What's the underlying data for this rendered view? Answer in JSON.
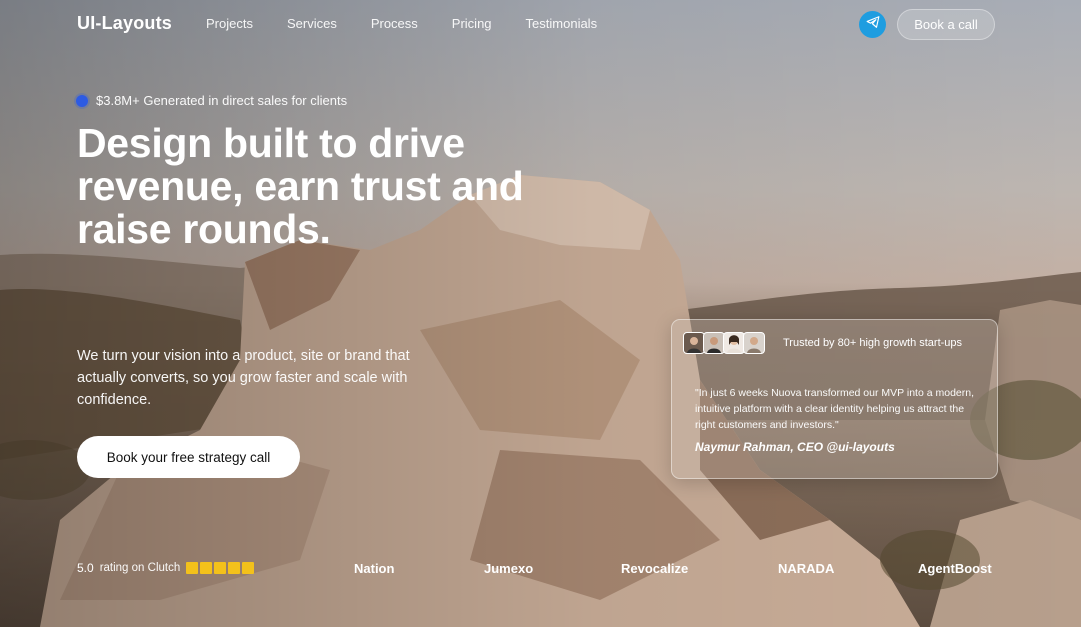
{
  "colors": {
    "accent_blue": "#2d5be3",
    "telegram_blue": "#1f9de0",
    "star_yellow": "#f3c11b"
  },
  "nav": {
    "logo": "UI-Layouts",
    "links": [
      "Projects",
      "Services",
      "Process",
      "Pricing",
      "Testimonials"
    ],
    "telegram_icon": "paper-plane-icon",
    "book_call": "Book a call"
  },
  "hero": {
    "badge_text": "$3.8M+ Generated in direct sales for clients",
    "headline": "Design built to drive revenue, earn trust and raise rounds.",
    "subtext": "We turn your vision into a product, site or brand that actually converts, so you grow faster and scale with confidence.",
    "cta": "Book your free strategy call"
  },
  "card": {
    "trusted": "Trusted by 80+ high growth start-ups",
    "quote": "\"In just 6 weeks Nuova transformed our MVP into a modern, intuitive platform with a clear identity helping us attract the right customers and investors.\"",
    "author": "Naymur Rahman, CEO @ui-layouts"
  },
  "footer": {
    "rating_value": "5.0",
    "rating_text": "rating on Clutch",
    "stars": 5,
    "brands": [
      "Nation",
      "Jumexo",
      "Revocalize",
      "NARADA",
      "AgentBoost"
    ]
  }
}
